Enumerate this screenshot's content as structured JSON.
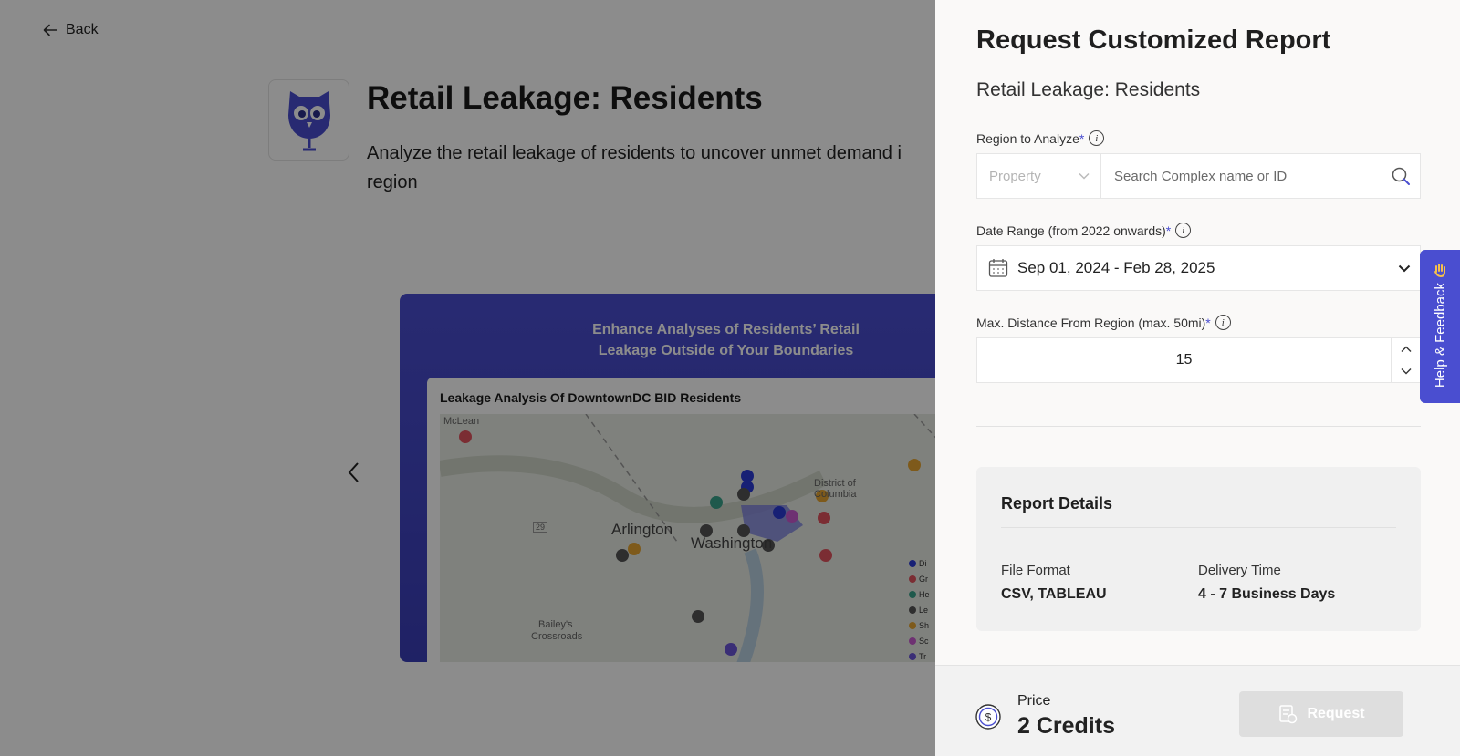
{
  "background": {
    "back_label": "Back",
    "title": "Retail Leakage: Residents",
    "description": "Analyze the retail leakage of residents to uncover unmet demand i region",
    "banner": {
      "title_line1": "Enhance Analyses of Residents’ Retail",
      "title_line2": "Leakage Outside of Your Boundaries",
      "card_title": "Leakage Analysis Of DowntownDC BID Residents",
      "map_labels": {
        "mclean": "McLean",
        "arlington": "Arlington",
        "washington": "Washington",
        "district": "District of",
        "columbia": "Columbia",
        "baileys": "Bailey's",
        "crossroads": "Crossroads",
        "route": "29"
      },
      "legend": [
        "Di",
        "Gr",
        "He",
        "Le",
        "Sh",
        "Sc",
        "Tr"
      ],
      "legend_colors": [
        "#2b3bd6",
        "#e0525e",
        "#3aa38b",
        "#555555",
        "#e5a532",
        "#c85ad0",
        "#6a55d8"
      ]
    }
  },
  "drawer": {
    "title": "Request Customized Report",
    "subtitle": "Retail Leakage: Residents",
    "region": {
      "label": "Region to Analyze",
      "required_mark": "*",
      "type_value": "Property",
      "search_placeholder": "Search Complex name or ID"
    },
    "date": {
      "label": "Date Range (from 2022 onwards)",
      "required_mark": "*",
      "value": "Sep 01, 2024 - Feb 28, 2025"
    },
    "distance": {
      "label": "Max. Distance From Region (max. 50mi)",
      "required_mark": "*",
      "value": "15"
    },
    "details": {
      "title": "Report Details",
      "file_format_label": "File Format",
      "file_format_value": "CSV, TABLEAU",
      "delivery_label": "Delivery Time",
      "delivery_value": "4 - 7 Business Days"
    },
    "footer": {
      "price_label": "Price",
      "price_value": "2 Credits",
      "request_label": "Request"
    }
  },
  "help_tab": {
    "label": "Help & Feedback"
  },
  "colors": {
    "accent": "#4a4ed0",
    "overlay": "rgba(0,0,0,0.45)"
  }
}
